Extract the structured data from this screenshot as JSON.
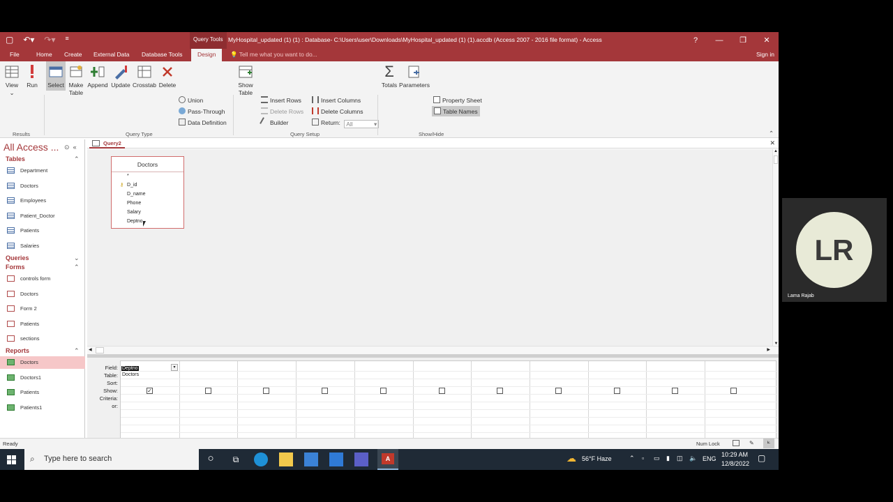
{
  "titlebar": {
    "context_tab": "Query Tools",
    "title": "MyHospital_updated (1) (1) : Database- C:\\Users\\user\\Downloads\\MyHospital_updated (1) (1).accdb (Access 2007 - 2016 file format) - Access",
    "help": "?",
    "minimize": "—",
    "restore": "❐",
    "close": "✕"
  },
  "menu": {
    "tabs": [
      "File",
      "Home",
      "Create",
      "External Data",
      "Database Tools",
      "Design"
    ],
    "tellme": "Tell me what you want to do...",
    "signin": "Sign in"
  },
  "ribbon": {
    "view": "View",
    "run": "Run",
    "select": "Select",
    "make_table": "Make\nTable",
    "append": "Append",
    "update": "Update",
    "crosstab": "Crosstab",
    "delete": "Delete",
    "union": "Union",
    "pass_through": "Pass-Through",
    "data_definition": "Data Definition",
    "show_table": "Show\nTable",
    "insert_rows": "Insert Rows",
    "delete_rows": "Delete Rows",
    "builder": "Builder",
    "insert_columns": "Insert Columns",
    "delete_columns": "Delete Columns",
    "return_label": "Return:",
    "return_value": "All",
    "totals": "Totals",
    "parameters": "Parameters",
    "property_sheet": "Property Sheet",
    "table_names": "Table Names",
    "groups": {
      "results": "Results",
      "query_type": "Query Type",
      "query_setup": "Query Setup",
      "show_hide": "Show/Hide"
    }
  },
  "nav": {
    "title": "All Access ...",
    "sections": {
      "tables": "Tables",
      "queries": "Queries",
      "forms": "Forms",
      "reports": "Reports"
    },
    "tables": [
      "Department",
      "Doctors",
      "Employees",
      "Patient_Doctor",
      "Patients",
      "Salaries"
    ],
    "forms": [
      "controls form",
      "Doctors",
      "Form 2",
      "Patients",
      "sections"
    ],
    "reports": [
      "Doctors",
      "Doctors1",
      "Patients",
      "Patients1"
    ]
  },
  "query_tab": "Query2",
  "table_box": {
    "title": "Doctors",
    "fields": [
      "*",
      "D_id",
      "D_name",
      "Phone",
      "Salary",
      "Deptno"
    ]
  },
  "grid": {
    "row_labels": [
      "Field:",
      "Table:",
      "Sort:",
      "Show:",
      "Criteria:",
      "or:"
    ],
    "first_field": "Deptno",
    "first_table": "Doctors"
  },
  "status": {
    "left": "Ready",
    "numlock": "Num Lock"
  },
  "taskbar": {
    "search_placeholder": "Type here to search",
    "weather": "56°F  Haze",
    "lang": "ENG",
    "time": "10:29 AM",
    "date": "12/8/2022"
  },
  "video": {
    "initials": "LR",
    "name": "Lama Rajab"
  }
}
